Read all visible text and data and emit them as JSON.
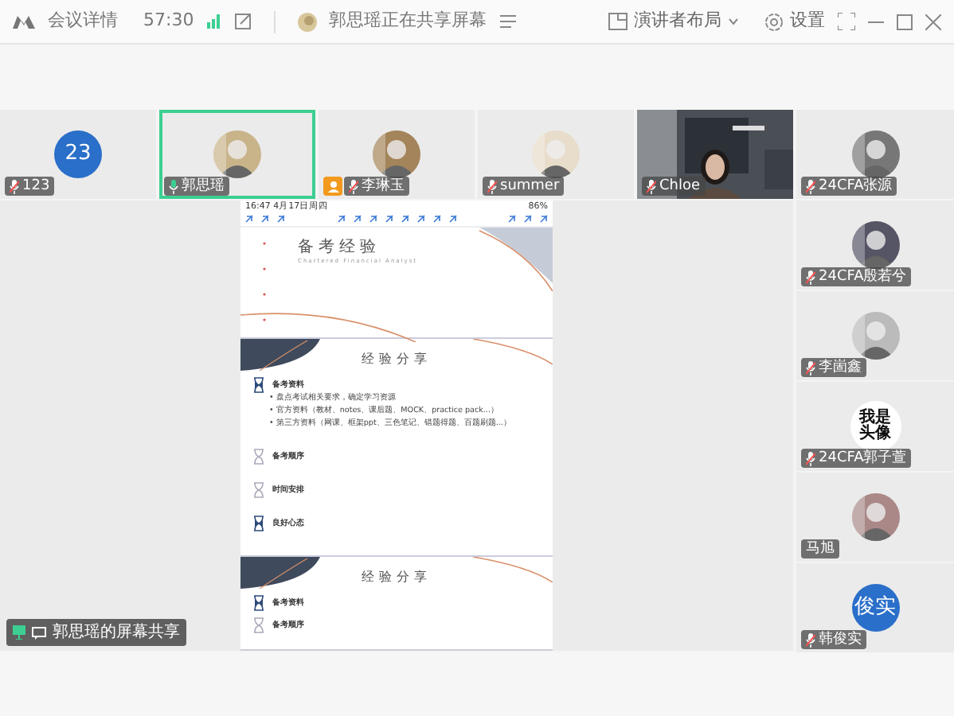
{
  "title_bar": {
    "meeting_info": "会议详情",
    "timer": "57:30",
    "share_status": "郭思瑶正在共享屏幕",
    "layout_button": "演讲者布局",
    "settings": "设置"
  },
  "top_tiles": [
    {
      "name": "123",
      "muted": true,
      "speaking": false,
      "host": false,
      "selected": false,
      "avatar": {
        "kind": "initials",
        "text": "23"
      }
    },
    {
      "name": "郭思瑶",
      "muted": false,
      "speaking": true,
      "host": false,
      "selected": true
    },
    {
      "name": "李琳玉",
      "muted": true,
      "speaking": false,
      "host": true,
      "selected": false
    },
    {
      "name": "summer",
      "muted": true,
      "speaking": false,
      "host": false,
      "selected": false
    },
    {
      "name": "Chloe",
      "muted": true,
      "speaking": false,
      "host": false,
      "selected": false,
      "avatar": {
        "kind": "video"
      }
    },
    {
      "name": "24CFA张源",
      "muted": true,
      "speaking": false,
      "host": false,
      "selected": false
    }
  ],
  "side_tiles": [
    {
      "name": "24CFA殷若兮",
      "muted": true,
      "speaking": false,
      "host": false,
      "selected": false
    },
    {
      "name": "李崮鑫",
      "muted": true,
      "speaking": false,
      "host": false,
      "selected": false
    },
    {
      "name": "24CFA郭子萱",
      "muted": true,
      "speaking": false,
      "host": false,
      "selected": false,
      "avatar": {
        "kind": "text-image",
        "text": "我是头像"
      }
    },
    {
      "name": "马旭",
      "muted": false,
      "speaking": false,
      "host": false,
      "selected": false
    },
    {
      "name": "韩俊实",
      "muted": true,
      "speaking": false,
      "host": false,
      "selected": false,
      "avatar": {
        "kind": "initials",
        "text": "俊实"
      }
    }
  ],
  "shared_screen": {
    "label": "郭思瑶的屏幕共享",
    "status_time": "16:47 4月17日周四",
    "battery": "86%",
    "slide1": {
      "title": "备考经验",
      "subtitle": "Chartered Financial Analyst"
    },
    "slide2": {
      "title": "经验分享",
      "sections": [
        {
          "heading": "备考资料",
          "active": true,
          "bullets": [
            "• 盘点考试相关要求，确定学习资源",
            "• 官方资料（教材、notes、课后题、MOCK、practice pack...）",
            "• 第三方资料（网课、框架ppt、三色笔记、错题得题、百题刷题...）"
          ]
        },
        {
          "heading": "备考顺序",
          "active": false
        },
        {
          "heading": "时间安排",
          "active": false
        },
        {
          "heading": "良好心态",
          "active": true
        }
      ]
    },
    "slide3": {
      "title": "经验分享",
      "sections": [
        {
          "heading": "备考资料",
          "active": true
        },
        {
          "heading": "备考顺序",
          "active": false
        }
      ]
    }
  }
}
